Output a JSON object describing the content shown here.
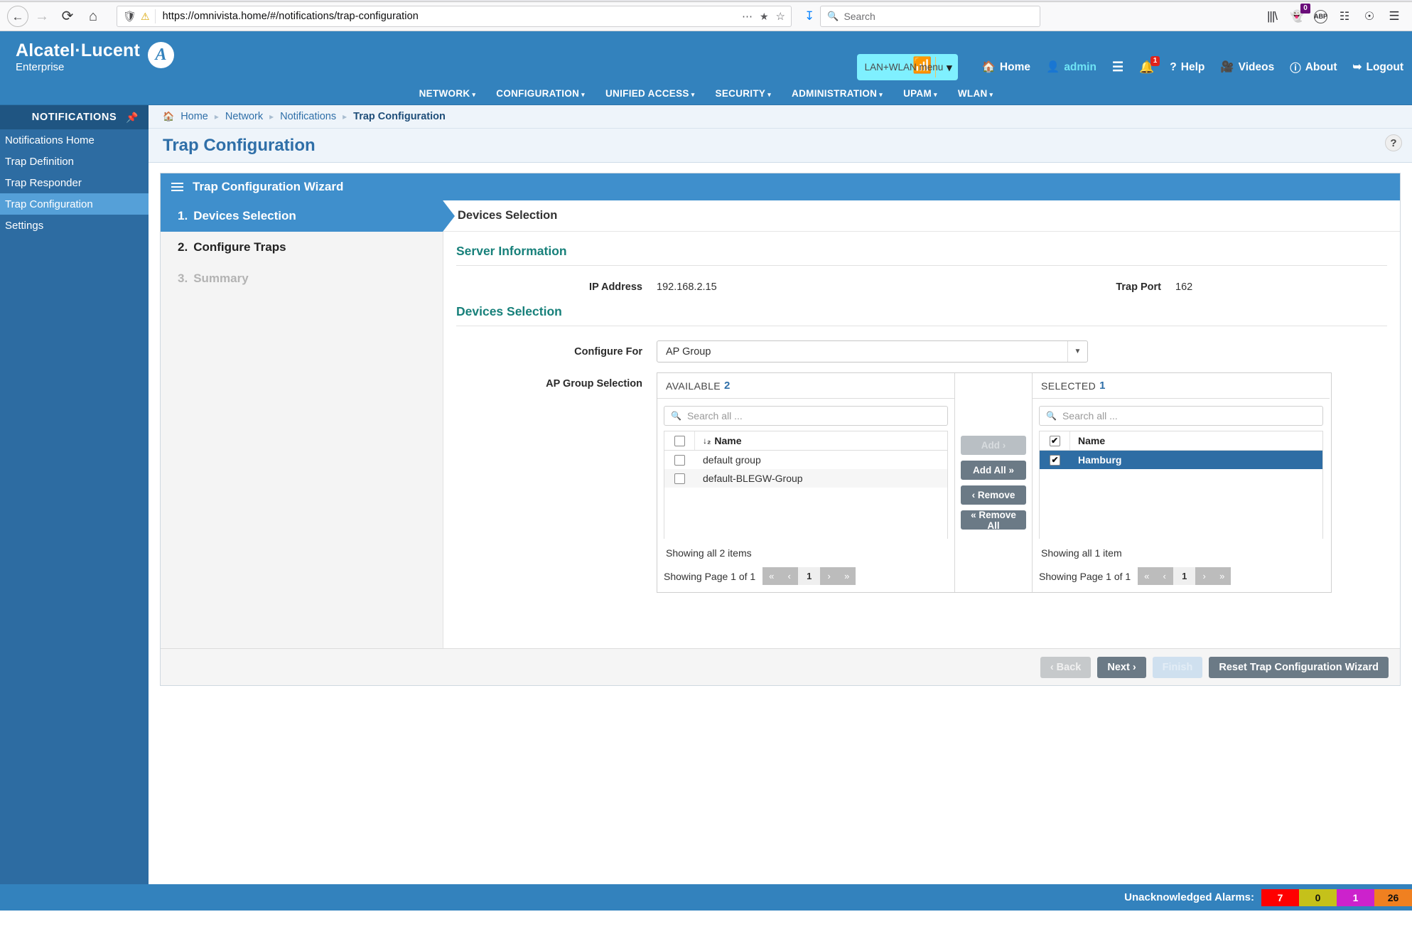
{
  "browser": {
    "back_icon": "arrow-left-icon",
    "forward_icon": "arrow-right-icon",
    "reload_icon": "reload-icon",
    "home_icon": "home-icon",
    "url_shield_icon": "shield-icon",
    "url_lock_warning_icon": "lock-warning-icon",
    "url": "https://omnivista.home/#/notifications/trap-configuration",
    "url_host": "omnivista.home",
    "url_path": "/#/notifications/trap-configuration",
    "url_scheme": "https://",
    "more_icon": "ellipsis-icon",
    "pocket_icon": "pocket-icon",
    "bookmark_icon": "star-icon",
    "download_icon": "download-arrow-icon",
    "search_placeholder": "Search",
    "search_icon": "search-icon",
    "library_icon": "library-icon",
    "ghostery_icon": "ghostery-icon",
    "ghostery_badge": "0",
    "adblock_icon": "adblock-plus-icon",
    "sidebar_icon": "sidebar-toggle-icon",
    "account_icon": "account-icon",
    "menu_icon": "hamburger-menu-icon"
  },
  "header": {
    "brand_line1": "Alcatel·Lucent",
    "brand_line2": "Enterprise",
    "brand_mark": "al-logo-icon",
    "context_menu": {
      "label": "LAN+WLAN",
      "suffix": "menu",
      "caret_icon": "chevron-down-icon"
    },
    "nav": [
      {
        "label": "Home",
        "icon": "home-icon"
      },
      {
        "label": "admin",
        "icon": "user-icon"
      },
      {
        "label": "",
        "icon": "list-icon"
      },
      {
        "label": "",
        "icon": "bell-icon",
        "badge": "1"
      },
      {
        "label": "Help",
        "icon": "question-icon"
      },
      {
        "label": "Videos",
        "icon": "video-icon"
      },
      {
        "label": "About",
        "icon": "info-icon"
      },
      {
        "label": "Logout",
        "icon": "logout-icon"
      }
    ],
    "mainnav": [
      "NETWORK",
      "CONFIGURATION",
      "UNIFIED ACCESS",
      "SECURITY",
      "ADMINISTRATION",
      "UPAM",
      "WLAN"
    ]
  },
  "sidebar": {
    "title": "NOTIFICATIONS",
    "pin_icon": "pin-icon",
    "items": [
      {
        "label": "Notifications Home",
        "active": false
      },
      {
        "label": "Trap Definition",
        "active": false
      },
      {
        "label": "Trap Responder",
        "active": false
      },
      {
        "label": "Trap Configuration",
        "active": true
      },
      {
        "label": "Settings",
        "active": false
      }
    ]
  },
  "breadcrumb": {
    "home_icon": "home-icon",
    "items": [
      "Home",
      "Network",
      "Notifications",
      "Trap Configuration"
    ],
    "separator": "›"
  },
  "page": {
    "title": "Trap Configuration",
    "help_icon": "question-mark-icon",
    "help_label": "?"
  },
  "wizard": {
    "menu_icon": "hamburger-icon",
    "title": "Trap Configuration Wizard",
    "steps": [
      {
        "num": "1.",
        "label": "Devices Selection",
        "state": "active"
      },
      {
        "num": "2.",
        "label": "Configure Traps",
        "state": "normal"
      },
      {
        "num": "3.",
        "label": "Summary",
        "state": "disabled"
      }
    ],
    "panel_title": "Devices Selection",
    "server_section": {
      "title": "Server Information",
      "ip_label": "IP Address",
      "ip_value": "192.168.2.15",
      "port_label": "Trap Port",
      "port_value": "162"
    },
    "devices_section": {
      "title": "Devices Selection",
      "configure_for_label": "Configure For",
      "configure_for_value": "AP Group",
      "configure_for_caret": "chevron-down-icon",
      "selection_label": "AP Group Selection"
    },
    "available": {
      "title": "AVAILABLE",
      "count": "2",
      "search_placeholder": "Search all ...",
      "search_icon": "search-icon",
      "sort_icon": "sort-asc-icon",
      "column": "Name",
      "rows": [
        {
          "name": "default group",
          "checked": false,
          "selected": false
        },
        {
          "name": "default-BLEGW-Group",
          "checked": false,
          "selected": false
        }
      ],
      "header_checked": false,
      "showing": "Showing all 2 items",
      "page_label": "Showing Page 1 of 1",
      "pager": {
        "first": "«",
        "prev": "‹",
        "current": "1",
        "next": "›",
        "last": "»"
      }
    },
    "transfer_buttons": [
      {
        "label": "Add ›",
        "disabled": true
      },
      {
        "label": "Add All »",
        "disabled": false
      },
      {
        "label": "‹ Remove",
        "disabled": false
      },
      {
        "label": "« Remove All",
        "disabled": false
      }
    ],
    "selected": {
      "title": "SELECTED",
      "count": "1",
      "search_placeholder": "Search all ...",
      "search_icon": "search-icon",
      "column": "Name",
      "header_checked": true,
      "rows": [
        {
          "name": "Hamburg",
          "checked": true,
          "selected": true
        }
      ],
      "showing": "Showing all 1 item",
      "page_label": "Showing Page 1 of 1",
      "pager": {
        "first": "«",
        "prev": "‹",
        "current": "1",
        "next": "›",
        "last": "»"
      }
    },
    "footer_buttons": [
      {
        "label": "‹ Back",
        "style": "ghost"
      },
      {
        "label": "Next ›",
        "style": "solid"
      },
      {
        "label": "Finish",
        "style": "finish"
      },
      {
        "label": "Reset Trap Configuration Wizard",
        "style": "solid"
      }
    ]
  },
  "footer": {
    "alarms_label": "Unacknowledged Alarms:",
    "alarms": [
      {
        "value": "7",
        "color": "#ff0000"
      },
      {
        "value": "0",
        "color": "#c5c11a"
      },
      {
        "value": "1",
        "color": "#cc22cc"
      },
      {
        "value": "26",
        "color": "#f08020"
      }
    ]
  },
  "colors": {
    "brand_blue": "#3382bd",
    "sidebar_blue": "#2d6ca2",
    "accent_teal": "#17807a",
    "selected_row": "#2e6da4"
  }
}
